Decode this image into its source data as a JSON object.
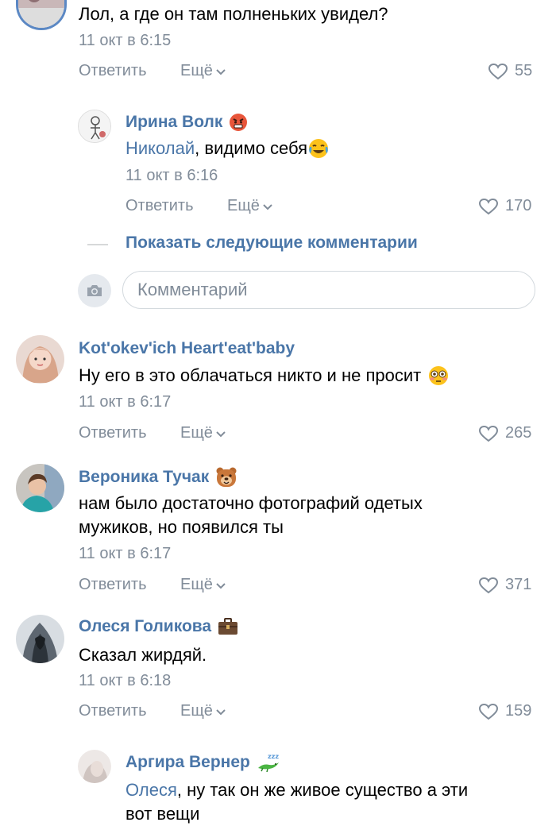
{
  "comments": [
    {
      "text": "Лол, а где он там полненьких увидел?",
      "date": "11 окт в 6:15",
      "reply": "Ответить",
      "more": "Ещё",
      "likes": "55"
    },
    {
      "author": "Ирина Волк",
      "mention": "Николай",
      "text": ", видимо себя",
      "date": "11 окт в 6:16",
      "reply": "Ответить",
      "more": "Ещё",
      "likes": "170"
    },
    {
      "author": "Kot'okev'ich Heart'eat'baby",
      "text": "Ну его в это облачаться никто и не просит",
      "date": "11 окт в 6:17",
      "reply": "Ответить",
      "more": "Ещё",
      "likes": "265"
    },
    {
      "author": "Вероника Тучак",
      "text_line1": "нам было достаточно фотографий одетых",
      "text_line2": "мужиков, но появился ты",
      "date": "11 окт в 6:17",
      "reply": "Ответить",
      "more": "Ещё",
      "likes": "371"
    },
    {
      "author": "Олеся Голикова",
      "text": "Сказал жирдяй.",
      "date": "11 окт в 6:18",
      "reply": "Ответить",
      "more": "Ещё",
      "likes": "159"
    },
    {
      "author": "Аргира Вернер",
      "mention": "Олеся",
      "text_line1": ", ну так он же живое существо а эти",
      "text_line2": "вот вещи"
    }
  ],
  "show_more": "Показать следующие комментарии",
  "comment_input": {
    "placeholder": "Комментарий"
  },
  "colors": {
    "link": "#4a76a8",
    "secondary": "#818c99",
    "input_border": "#d3d9de"
  },
  "icons": {
    "like": "heart-outline-icon",
    "more": "chevron-down-icon",
    "camera": "camera-icon",
    "emoji_angry": "angry-face-emoji",
    "emoji_laugh": "tears-of-joy-emoji",
    "emoji_flushed": "flushed-face-emoji",
    "emoji_bear": "bear-face-emoji",
    "emoji_briefcase": "briefcase-emoji",
    "emoji_sleep": "sleeping-lizard-emoji"
  }
}
